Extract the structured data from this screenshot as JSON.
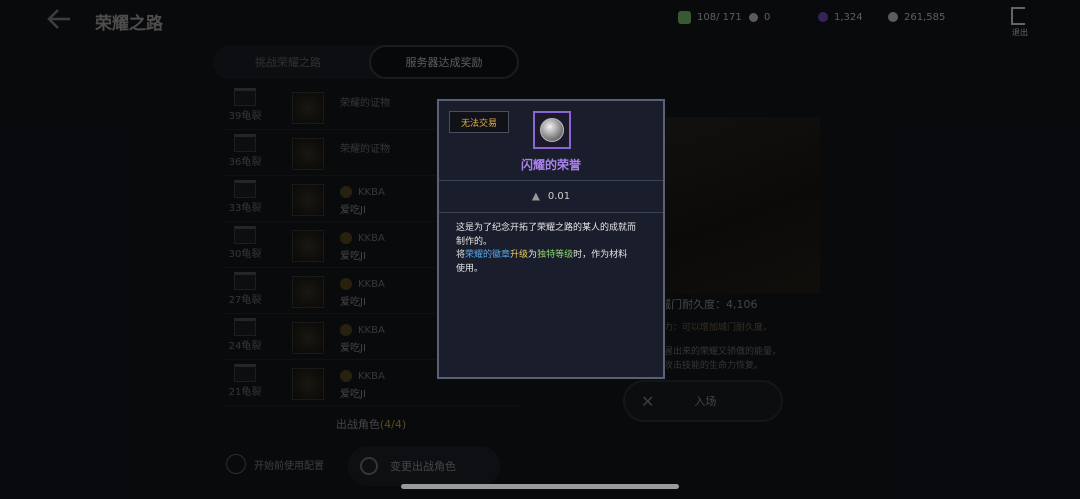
{
  "header": {
    "title": "荣耀之路",
    "resources": [
      {
        "name": "stamina",
        "value": "108/ 171",
        "color": "#7cc56e"
      },
      {
        "name": "pearl",
        "value": "0",
        "color": "#d0c8c8"
      },
      {
        "name": "crystal",
        "value": "1,324",
        "color": "#7a4fc8"
      },
      {
        "name": "silver",
        "value": "261,585",
        "color": "#c8d0d8"
      }
    ],
    "exit_label": "退出"
  },
  "tabs": [
    {
      "label": "挑战荣耀之路"
    },
    {
      "label": "服务器达成奖励"
    }
  ],
  "list": [
    {
      "rank": "39龟裂",
      "title": "荣耀的证物"
    },
    {
      "rank": "36龟裂",
      "title": "荣耀的证物"
    },
    {
      "rank": "33龟裂",
      "guild": "KKBA",
      "player": "爱吃JI"
    },
    {
      "rank": "30龟裂",
      "guild": "KKBA",
      "player": "爱吃JI"
    },
    {
      "rank": "27龟裂",
      "guild": "KKBA",
      "player": "爱吃JI"
    },
    {
      "rank": "24龟裂",
      "guild": "KKBA",
      "player": "爱吃JI"
    },
    {
      "rank": "21龟裂",
      "guild": "KKBA",
      "player": "爱吃JI"
    }
  ],
  "party": {
    "label": "出战角色",
    "count": "(4/4)"
  },
  "preset_label": "开始前使用配置",
  "change_button": "变更出战角色",
  "right": {
    "durability": "城门耐久度：4,106",
    "hint": "力：可以增加城门耐久度。",
    "desc1": "冒出来的荣耀又骄傲的能量，",
    "desc2": "攻击技能的生命力恢复。",
    "enter_button": "入场"
  },
  "popup": {
    "badge": "无法交易",
    "item_name": "闪耀的荣誉",
    "weight": "0.01",
    "desc": {
      "line1": "这是为了纪念开拓了荣耀之路的某人的成就而",
      "line2": "制作的。",
      "p3a": "将",
      "p3b": "荣耀的徽章",
      "p3c": "升级",
      "p3d": "为",
      "p3e": "独特等级",
      "p3f": "时，作为材料",
      "line4": "使用。"
    }
  }
}
